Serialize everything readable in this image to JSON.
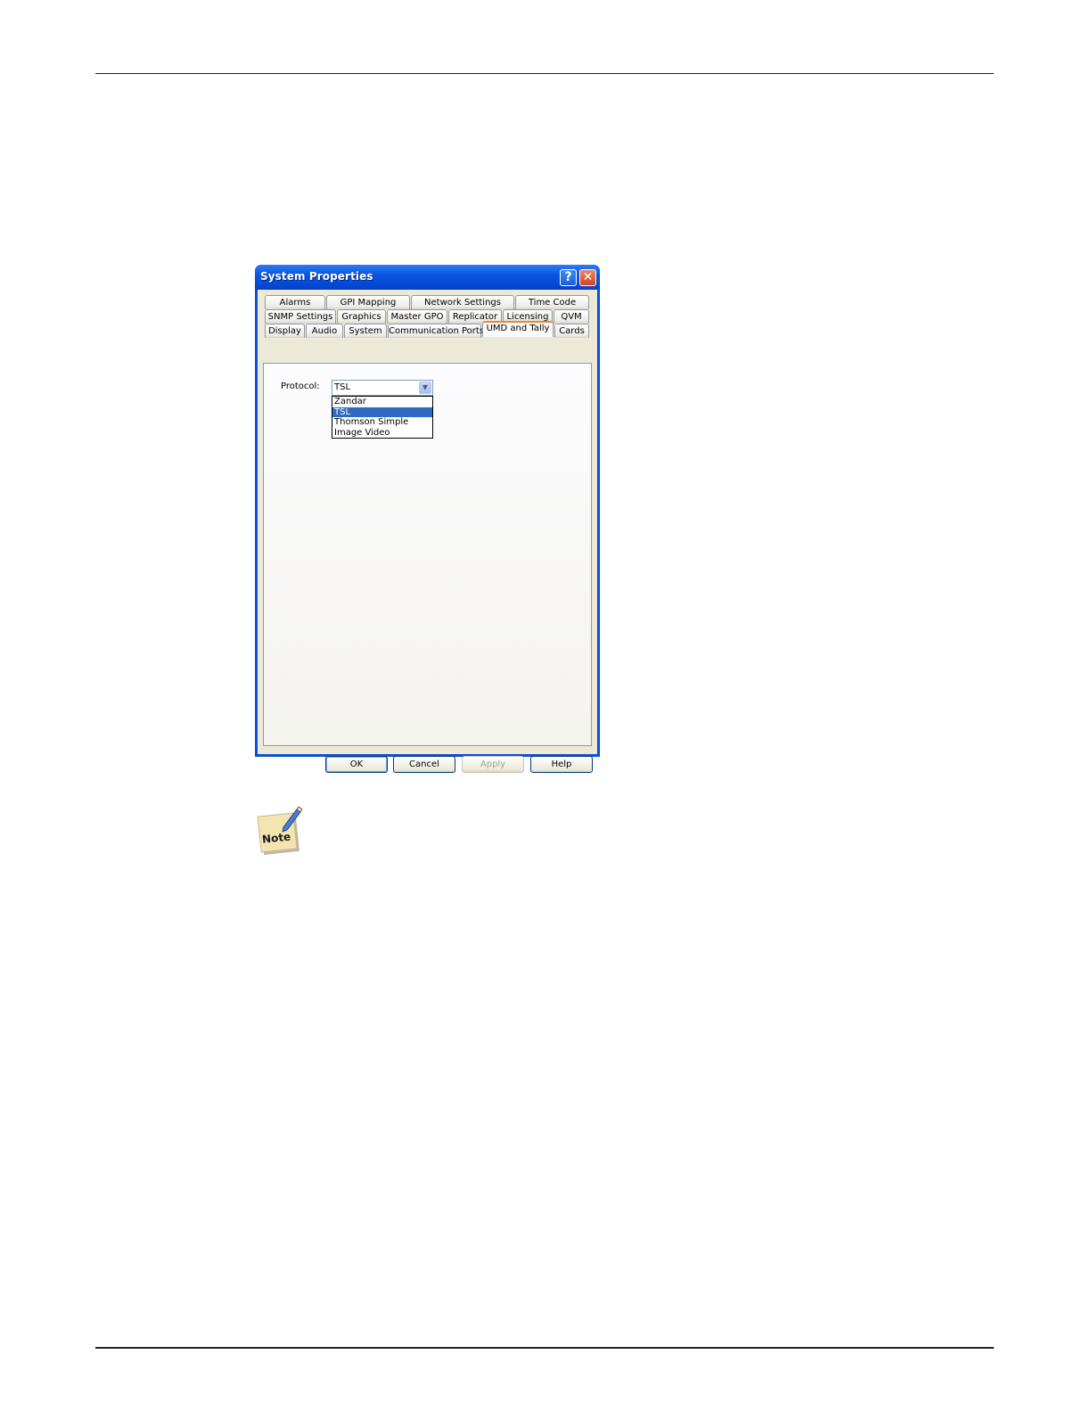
{
  "dialog": {
    "title": "System Properties",
    "help_glyph": "?",
    "close_glyph": "✕",
    "tabs_row1": [
      "Alarms",
      "GPI Mapping",
      "Network Settings",
      "Time Code"
    ],
    "tabs_row2": [
      "SNMP Settings",
      "Graphics",
      "Master GPO",
      "Replicator",
      "Licensing",
      "QVM"
    ],
    "tabs_row3": [
      "Display",
      "Audio",
      "System",
      "Communication Ports",
      "UMD and Tally",
      "Cards"
    ],
    "active_tab": "UMD and Tally",
    "protocol": {
      "label": "Protocol:",
      "value": "TSL",
      "options": [
        "Zandar",
        "TSL",
        "Thomson Simple",
        "Image Video"
      ],
      "selected": "TSL"
    },
    "buttons": {
      "ok": "OK",
      "cancel": "Cancel",
      "apply": "Apply",
      "help": "Help"
    }
  },
  "note": {
    "label": "Note",
    "icon": "note-pencil-icon"
  }
}
